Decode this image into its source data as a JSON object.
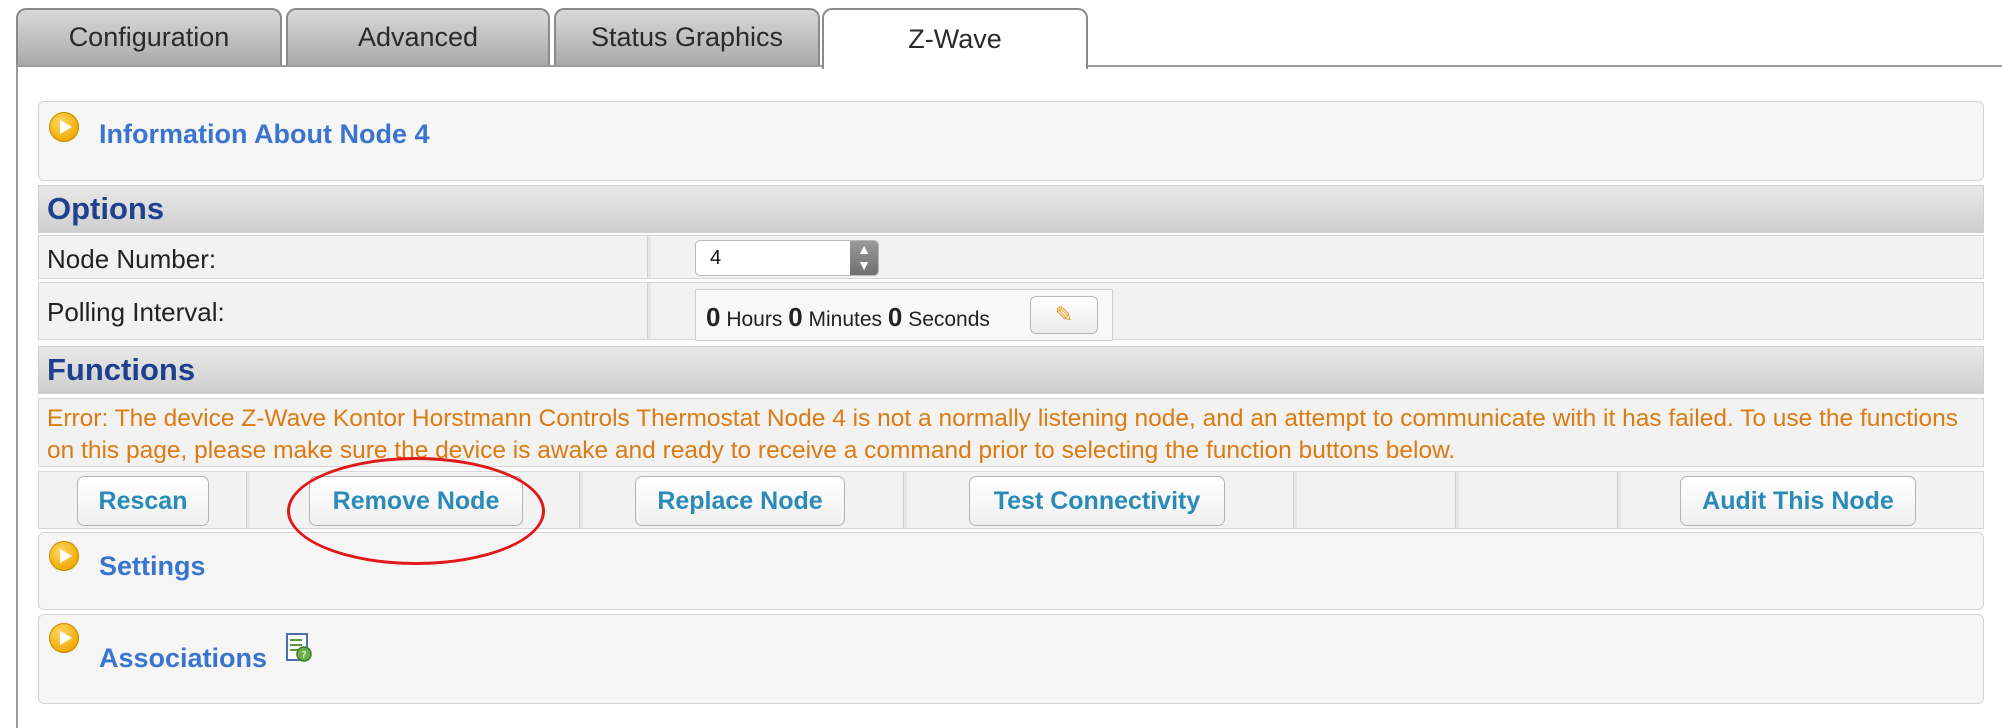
{
  "tabs": [
    {
      "label": "Configuration",
      "active": false
    },
    {
      "label": "Advanced",
      "active": false
    },
    {
      "label": "Status Graphics",
      "active": false
    },
    {
      "label": "Z-Wave",
      "active": true
    }
  ],
  "info_panel": {
    "title": "Information About Node 4",
    "icon": "play-circle-icon"
  },
  "options": {
    "header": "Options",
    "node_number_label": "Node Number:",
    "node_number_value": "4",
    "polling_label": "Polling Interval:",
    "polling": {
      "hours": "0",
      "hours_label": "Hours",
      "minutes": "0",
      "minutes_label": "Minutes",
      "seconds": "0",
      "seconds_label": "Seconds"
    },
    "edit_icon": "pencil-icon"
  },
  "functions": {
    "header": "Functions",
    "error_text": "Error: The device Z-Wave Kontor Horstmann Controls Thermostat Node 4 is not a normally listening node, and an attempt to communicate with it has failed. To use the functions on this page, please make sure the device is awake and ready to receive a command prior to selecting the function buttons below.",
    "buttons": {
      "rescan": "Rescan",
      "remove_node": "Remove Node",
      "replace_node": "Replace Node",
      "test_connectivity": "Test Connectivity",
      "audit": "Audit This Node"
    }
  },
  "settings_panel": {
    "title": "Settings",
    "icon": "play-circle-icon"
  },
  "associations_panel": {
    "title": "Associations",
    "icon": "play-circle-icon",
    "help_icon": "help-document-icon"
  },
  "colors": {
    "panel_title": "#3a74cf",
    "section_header": "#1f3f8f",
    "error_text": "#dd7a10",
    "button_text": "#2a8ab8",
    "annotation": "#e01818"
  }
}
